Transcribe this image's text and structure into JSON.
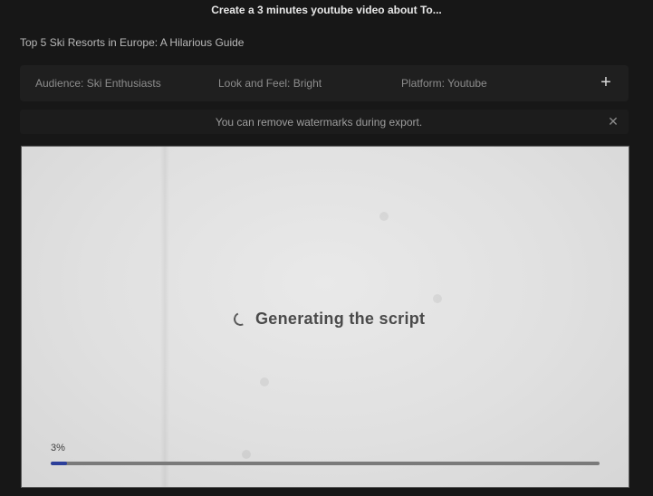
{
  "header": {
    "title": "Create a 3 minutes youtube video about To..."
  },
  "video": {
    "title": "Top 5 Ski Resorts in Europe: A Hilarious Guide"
  },
  "params": {
    "audience": "Audience: Ski Enthusiasts",
    "look_and_feel": "Look and Feel: Bright",
    "platform": "Platform: Youtube",
    "add_symbol": "+",
    "add_icon": "plus-icon"
  },
  "notice": {
    "text": "You can remove watermarks during export.",
    "close_symbol": "✕",
    "close_icon": "close-icon"
  },
  "preview": {
    "status_text": "Generating the script",
    "spinner_icon": "spinner-icon",
    "progress_label": "3%",
    "progress_value": 0.03,
    "progress_color": "#2c3f9a"
  }
}
